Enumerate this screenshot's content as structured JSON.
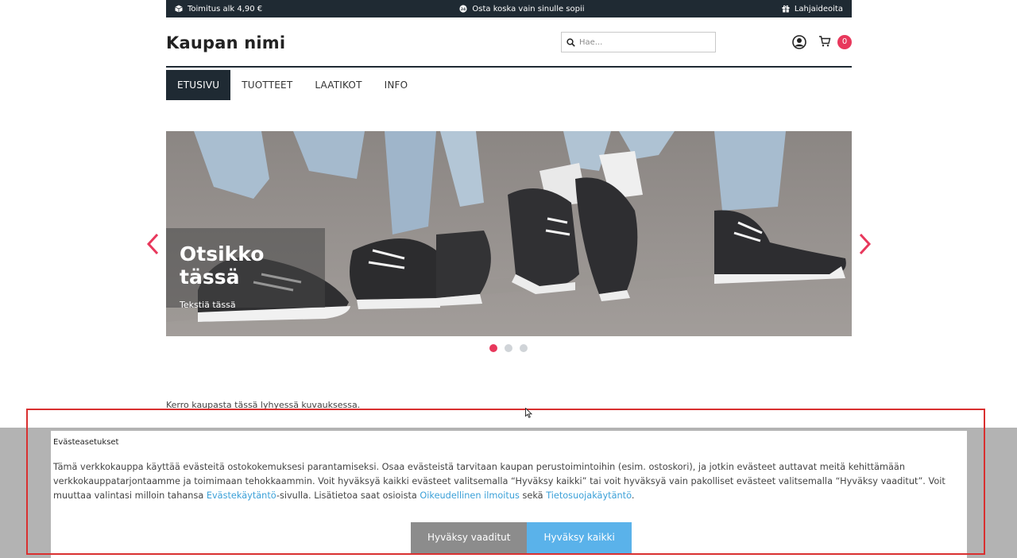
{
  "topbar": {
    "shipping": "Toimitus alk 4,90 €",
    "promo": "Osta koska vain sinulle sopii",
    "gifts": "Lahjaideoita"
  },
  "header": {
    "store_name": "Kaupan nimi",
    "search_placeholder": "Hae...",
    "cart_count": "0"
  },
  "nav": {
    "items": [
      "ETUSIVU",
      "TUOTTEET",
      "LAATIKOT",
      "INFO"
    ],
    "active": "ETUSIVU"
  },
  "hero": {
    "title": "Otsikko tässä",
    "text": "Tekstiä tässä",
    "slides": 3,
    "active_slide": 1
  },
  "main": {
    "description": "Kerro kaupasta tässä lyhyessä kuvauksessa."
  },
  "cookie": {
    "title": "Evästeasetukset",
    "text_1": "Tämä verkkokauppa käyttää evästeitä ostokokemuksesi parantamiseksi. Osaa evästeistä tarvitaan kaupan perustoimintoihin (esim. ostoskori), ja jotkin evästeet auttavat meitä kehittämään verkkokauppatarjontaamme ja toimimaan tehokkaammin. Voit hyväksyä kaikki evästeet valitsemalla “Hyväksy kaikki” tai voit hyväksyä vain pakolliset evästeet valitsemalla “Hyväksy vaaditut”. Voit muuttaa valintasi milloin tahansa ",
    "link_policy": "Evästekäytäntö",
    "text_2": "-sivulla. Lisätietoa saat osioista ",
    "link_legal": "Oikeudellinen ilmoitus",
    "text_3": " sekä ",
    "link_privacy": "Tietosuojakäytäntö",
    "text_4": ".",
    "btn_required": "Hyväksy vaaditut",
    "btn_all": "Hyväksy kaikki"
  },
  "colors": {
    "dark": "#1f2a33",
    "accent": "#e8385c",
    "link": "#3aa0d8",
    "btn_blue": "#5ab2ea",
    "btn_grey": "#8c8c8c"
  }
}
